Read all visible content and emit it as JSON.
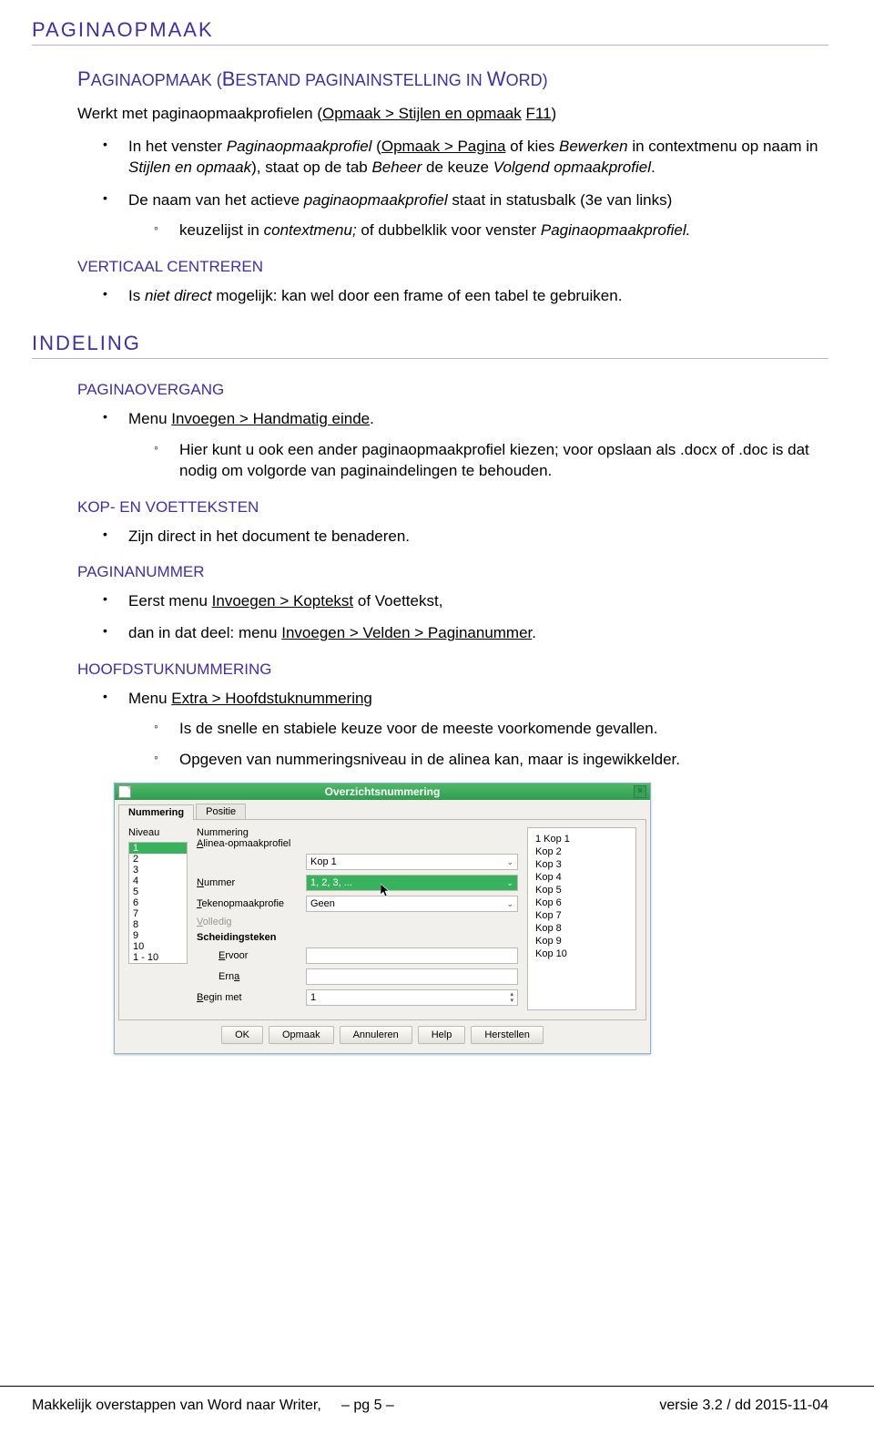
{
  "h1": "PAGINAOPMAAK",
  "h2_1_initcap": "P",
  "h2_1_rest_a": "AGINAOPMAAK",
  "h2_1_paren_open": " (",
  "h2_1_initcap2": "B",
  "h2_1_rest_b": "ESTAND PAGINAINSTELLING IN ",
  "h2_1_initcap3": "W",
  "h2_1_rest_c": "ORD",
  "h2_1_paren_close": ")",
  "p1_a": "Werkt met paginaopmaakprofielen (",
  "p1_u1": "Opmaak > Stijlen en opmaak",
  "p1_b": " ",
  "p1_u2": "F11",
  "p1_c": ")",
  "b1_a": "In het venster ",
  "b1_em1": "Paginaopmaakprofiel",
  "b1_b": " (",
  "b1_u1": "Opmaak > Pagina",
  "b1_c": " of kies ",
  "b1_em2": "Bewerken",
  "b1_d": " in contextmenu op naam in ",
  "b1_em3": "Stijlen en opmaak",
  "b1_e": "), staat op de tab ",
  "b1_em4": "Beheer",
  "b1_f": " de keuze ",
  "b1_em5": "Volgend opmaakprofiel",
  "b1_g": ".",
  "b2_a": "De naam van het actieve ",
  "b2_em1": "paginaopmaakprofiel",
  "b2_b": " staat in statusbalk (3e van links)",
  "b2s1_a": "keuzelijst in ",
  "b2s1_em1": "contextmenu;",
  "b2s1_b": " of dubbelklik voor venster ",
  "b2s1_em2": "Paginaopmaakprofiel.",
  "h3_vert": "VERTICAAL CENTREREN",
  "vert_b1_a": "Is ",
  "vert_b1_em1": "niet direct",
  "vert_b1_b": " mogelijk: kan wel door een frame of een tabel te gebruiken.",
  "h1_2": "INDELING",
  "h3_pag": "PAGINAOVERGANG",
  "pag_b1_a": "Menu ",
  "pag_b1_u1": "Invoegen > Handmatig einde",
  "pag_b1_b": ".",
  "pag_s1": "Hier kunt u ook een ander paginaopmaakprofiel kiezen; voor opslaan als .docx of .doc is dat nodig om volgorde van paginaindelingen te behouden.",
  "h3_kop": "KOP- EN VOETTEKSTEN",
  "kop_b1": "Zijn direct in het document te benaderen.",
  "h3_pnum": "PAGINANUMMER",
  "pnum_b1_a": "Eerst menu ",
  "pnum_b1_u1": "Invoegen > Koptekst",
  "pnum_b1_b": " of Voettekst,",
  "pnum_b2_a": "dan in dat deel: menu ",
  "pnum_b2_u1": "Invoegen > Velden > Paginanummer",
  "pnum_b2_b": ".",
  "h3_hnum": "HOOFDSTUKNUMMERING",
  "hnum_b1_a": "Menu ",
  "hnum_b1_u1": "Extra > Hoofdstuknummering",
  "hnum_s1": "Is de snelle en stabiele keuze voor de meeste voorkomende gevallen.",
  "hnum_s2": "Opgeven van nummeringsniveau in de alinea kan, maar is ingewikkelder.",
  "dialog": {
    "title": "Overzichtsnummering",
    "tab1": "Nummering",
    "tab2": "Positie",
    "niveau_label": "Niveau",
    "niveaus": [
      "1",
      "2",
      "3",
      "4",
      "5",
      "6",
      "7",
      "8",
      "9",
      "10",
      "1 - 10"
    ],
    "nummering_label": "Nummering",
    "f_alinea_lbl": "Alinea-opmaakprofiel",
    "f_alinea_val": "Kop 1",
    "f_nummer_lbl": "Nummer",
    "f_nummer_val": "1, 2, 3, ...",
    "f_teken_lbl": "Tekenopmaakprofie",
    "f_teken_val": "Geen",
    "f_volledig_lbl": "Volledig",
    "f_scheid_lbl": "Scheidingsteken",
    "f_ervoor_lbl": "Ervoor",
    "f_erna_lbl": "Erna",
    "f_begin_lbl": "Begin met",
    "f_begin_val": "1",
    "preview": [
      "1 Kop 1",
      "Kop 2",
      "Kop 3",
      "Kop 4",
      "Kop 5",
      "Kop 6",
      "Kop 7",
      "Kop 8",
      "Kop 9",
      "Kop 10"
    ],
    "btn_ok": "OK",
    "btn_opmaak": "Opmaak",
    "btn_annuleren": "Annuleren",
    "btn_help": "Help",
    "btn_herstellen": "Herstellen"
  },
  "footer_left": "Makkelijk overstappen van Word naar Writer,",
  "footer_mid": "– pg  5 –",
  "footer_right": "versie 3.2 / dd 2015-11-04"
}
